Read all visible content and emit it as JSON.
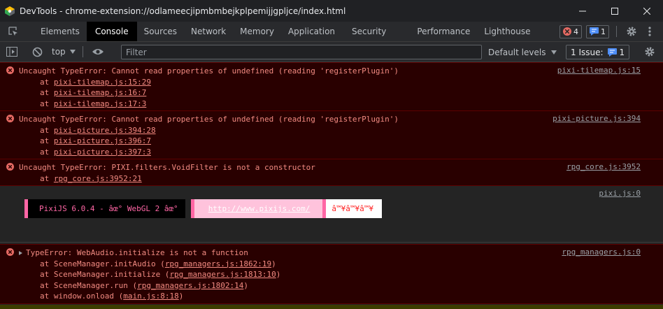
{
  "window": {
    "title": "DevTools - chrome-extension://odlameecjipmbmbejkplpemijjgpljce/index.html"
  },
  "tabs": [
    {
      "label": "Elements"
    },
    {
      "label": "Console"
    },
    {
      "label": "Sources"
    },
    {
      "label": "Network"
    },
    {
      "label": "Memory"
    },
    {
      "label": "Application"
    },
    {
      "label": "Security"
    },
    {
      "label": "Performance"
    },
    {
      "label": "Lighthouse"
    }
  ],
  "badges": {
    "errors": "4",
    "issues": "1"
  },
  "toolbar": {
    "context": "top",
    "filter_placeholder": "Filter",
    "levels": "Default levels",
    "issue_label": "1 Issue:",
    "issue_count": "1"
  },
  "messages": [
    {
      "text": "Uncaught TypeError: Cannot read properties of undefined (reading 'registerPlugin')",
      "source": "pixi-tilemap.js:15",
      "stack": [
        "pixi-tilemap.js:15:29",
        "pixi-tilemap.js:16:7",
        "pixi-tilemap.js:17:3"
      ]
    },
    {
      "text": "Uncaught TypeError: Cannot read properties of undefined (reading 'registerPlugin')",
      "source": "pixi-picture.js:394",
      "stack": [
        "pixi-picture.js:394:28",
        "pixi-picture.js:396:7",
        "pixi-picture.js:397:3"
      ]
    },
    {
      "text": "Uncaught TypeError: PIXI.filters.VoidFilter is not a constructor",
      "source": "rpg_core.js:3952",
      "stack": [
        "rpg_core.js:3952:21"
      ]
    }
  ],
  "pixi_info": {
    "source": "pixi.js:0",
    "version_text": "PixiJS 6.0.4 - âœ° WebGL 2 âœ°",
    "url": "http://www.pixijs.com/",
    "hearts": "â™¥â™¥â™¥"
  },
  "last_error": {
    "text": "TypeError: WebAudio.initialize is not a function",
    "source": "rpg_managers.js:0",
    "stack": [
      {
        "fn": "at SceneManager.initAudio (",
        "loc": "rpg_managers.js:1862:19",
        "end": ")"
      },
      {
        "fn": "at SceneManager.initialize (",
        "loc": "rpg_managers.js:1813:10",
        "end": ")"
      },
      {
        "fn": "at SceneManager.run (",
        "loc": "rpg_managers.js:1802:14",
        "end": ")"
      },
      {
        "fn": "at window.onload (",
        "loc": "main.js:8:18",
        "end": ")"
      }
    ]
  },
  "colors": {
    "error_bg": "#290000",
    "error_text": "#f28b82",
    "pixi_pink": "#ff66a5"
  }
}
